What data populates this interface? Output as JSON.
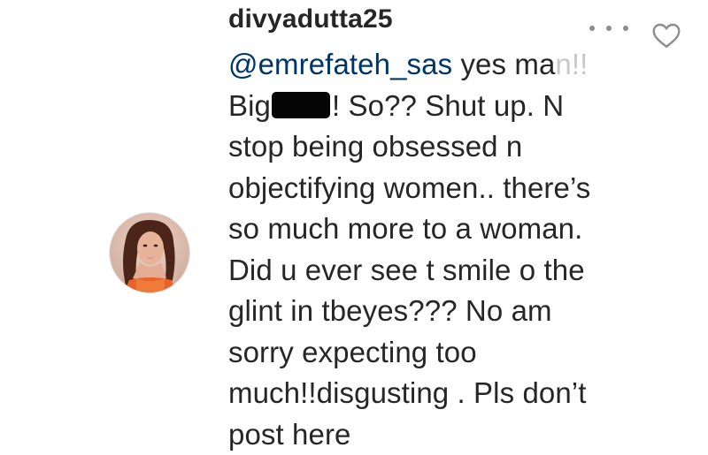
{
  "comment": {
    "username": "divyadutta25",
    "mention": "@emrefateh_sas",
    "line1_after_mention": " yes ma",
    "line1_faded": "n!!",
    "line2_before_redaction": "Big",
    "line2_after_redaction": "! So?? Shut up. N",
    "lines": [
      "stop being obsessed n",
      "objectifying women.. there’s",
      "so much more to a woman.",
      "Did u ever see t smile o the",
      "glint in tbeyes??? No am",
      "sorry expecting too",
      "much!!disgusting . Pls don’t",
      "post here"
    ]
  },
  "icons": {
    "more": "more-options-icon",
    "like": "heart-outline-icon",
    "avatar": "user-avatar"
  },
  "colors": {
    "text": "#262626",
    "mention": "#003569",
    "icon_gray": "#8e8e8e",
    "redaction": "#050505"
  }
}
